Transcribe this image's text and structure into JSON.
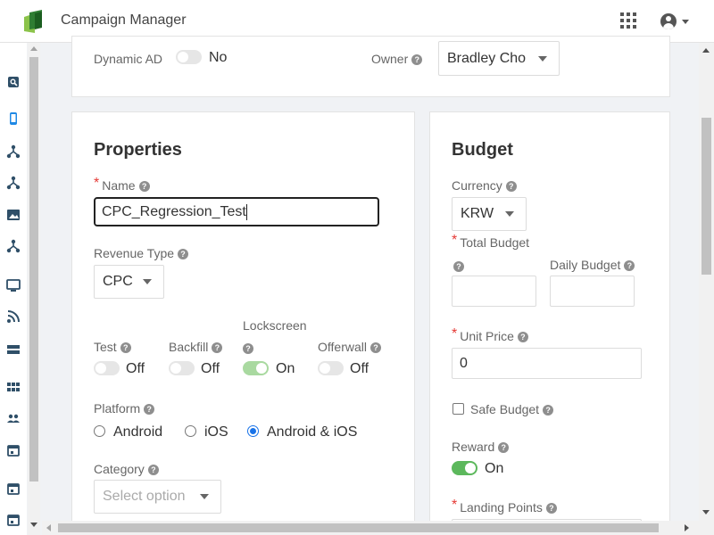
{
  "header": {
    "title": "Campaign Manager"
  },
  "top_card": {
    "dynamic_ad_label": "Dynamic AD",
    "dynamic_ad_value": "No",
    "owner_label": "Owner",
    "owner_value": "Bradley Cho"
  },
  "properties": {
    "heading": "Properties",
    "name_label": "Name",
    "name_value": "CPC_Regression_Test",
    "revenue_type_label": "Revenue Type",
    "revenue_type_value": "CPC",
    "test_label": "Test",
    "test_value": "Off",
    "backfill_label": "Backfill",
    "backfill_value": "Off",
    "lockscreen_label": "Lockscreen",
    "lockscreen_value": "On",
    "offerwall_label": "Offerwall",
    "offerwall_value": "Off",
    "platform_label": "Platform",
    "platform_options": [
      "Android",
      "iOS",
      "Android & iOS"
    ],
    "platform_selected": "Android & iOS",
    "category_label": "Category",
    "category_placeholder": "Select option"
  },
  "budget": {
    "heading": "Budget",
    "currency_label": "Currency",
    "currency_value": "KRW",
    "total_budget_label": "Total Budget",
    "daily_budget_label": "Daily Budget",
    "unit_price_label": "Unit Price",
    "unit_price_value": "0",
    "safe_budget_label": "Safe Budget",
    "reward_label": "Reward",
    "reward_value": "On",
    "landing_points_label": "Landing Points"
  },
  "colors": {
    "accent": "#1a73e8",
    "toggle_on": "#5cb85c",
    "required": "#e53935",
    "sidebar_icon": "#2f4f68"
  },
  "sidebar_icons": [
    "search-icon",
    "mobile-icon",
    "sitemap-icon",
    "sitemap-icon",
    "image-icon",
    "sitemap-icon",
    "monitor-icon",
    "rss-icon",
    "storage-icon",
    "grid-icon",
    "users-icon",
    "calendar-icon",
    "calendar-icon",
    "calendar-icon"
  ]
}
